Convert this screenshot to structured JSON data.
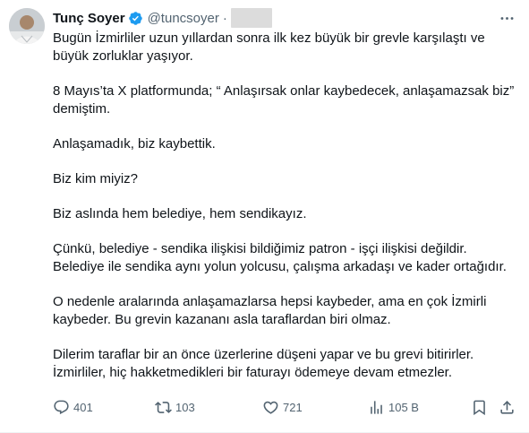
{
  "author": {
    "name": "Tunç Soyer",
    "handle": "@tuncsoyer",
    "separator": "·",
    "verified": true,
    "avatar_icon": "profile-avatar"
  },
  "tweet": {
    "paragraphs": [
      "Bugün İzmirliler uzun yıllardan sonra ilk kez büyük bir grevle karşılaştı ve büyük zorluklar yaşıyor.",
      "8 Mayıs’ta X platformunda; “ Anlaşırsak onlar kaybedecek, anlaşamazsak biz” demiştim.",
      "Anlaşamadık, biz kaybettik.",
      "Biz kim miyiz?",
      "Biz aslında hem belediye, hem sendikayız.",
      "Çünkü, belediye - sendika ilişkisi bildiğimiz patron - işçi ilişkisi değildir. Belediye ile sendika aynı yolun yolcusu, çalışma arkadaşı ve kader ortağıdır.",
      "O nedenle aralarında anlaşamazlarsa hepsi kaybeder, ama en çok İzmirli kaybeder. Bu grevin kazananı asla taraflardan biri olmaz.",
      "Dilerim taraflar bir an önce üzerlerine düşeni yapar ve  bu grevi bitirirler. İzmirliler, hiç hakketmedikleri bir faturayı ödemeye devam etmezler."
    ]
  },
  "actions": {
    "reply": {
      "icon": "reply-icon",
      "count": "401"
    },
    "retweet": {
      "icon": "retweet-icon",
      "count": "103"
    },
    "like": {
      "icon": "heart-icon",
      "count": "721"
    },
    "views": {
      "icon": "views-icon",
      "count": "105 B"
    },
    "bookmark": {
      "icon": "bookmark-icon"
    },
    "share": {
      "icon": "share-icon"
    }
  },
  "colors": {
    "text": "#0f1419",
    "secondary": "#536471",
    "verified": "#1d9bf0",
    "redaction": "#dcdcdc"
  }
}
